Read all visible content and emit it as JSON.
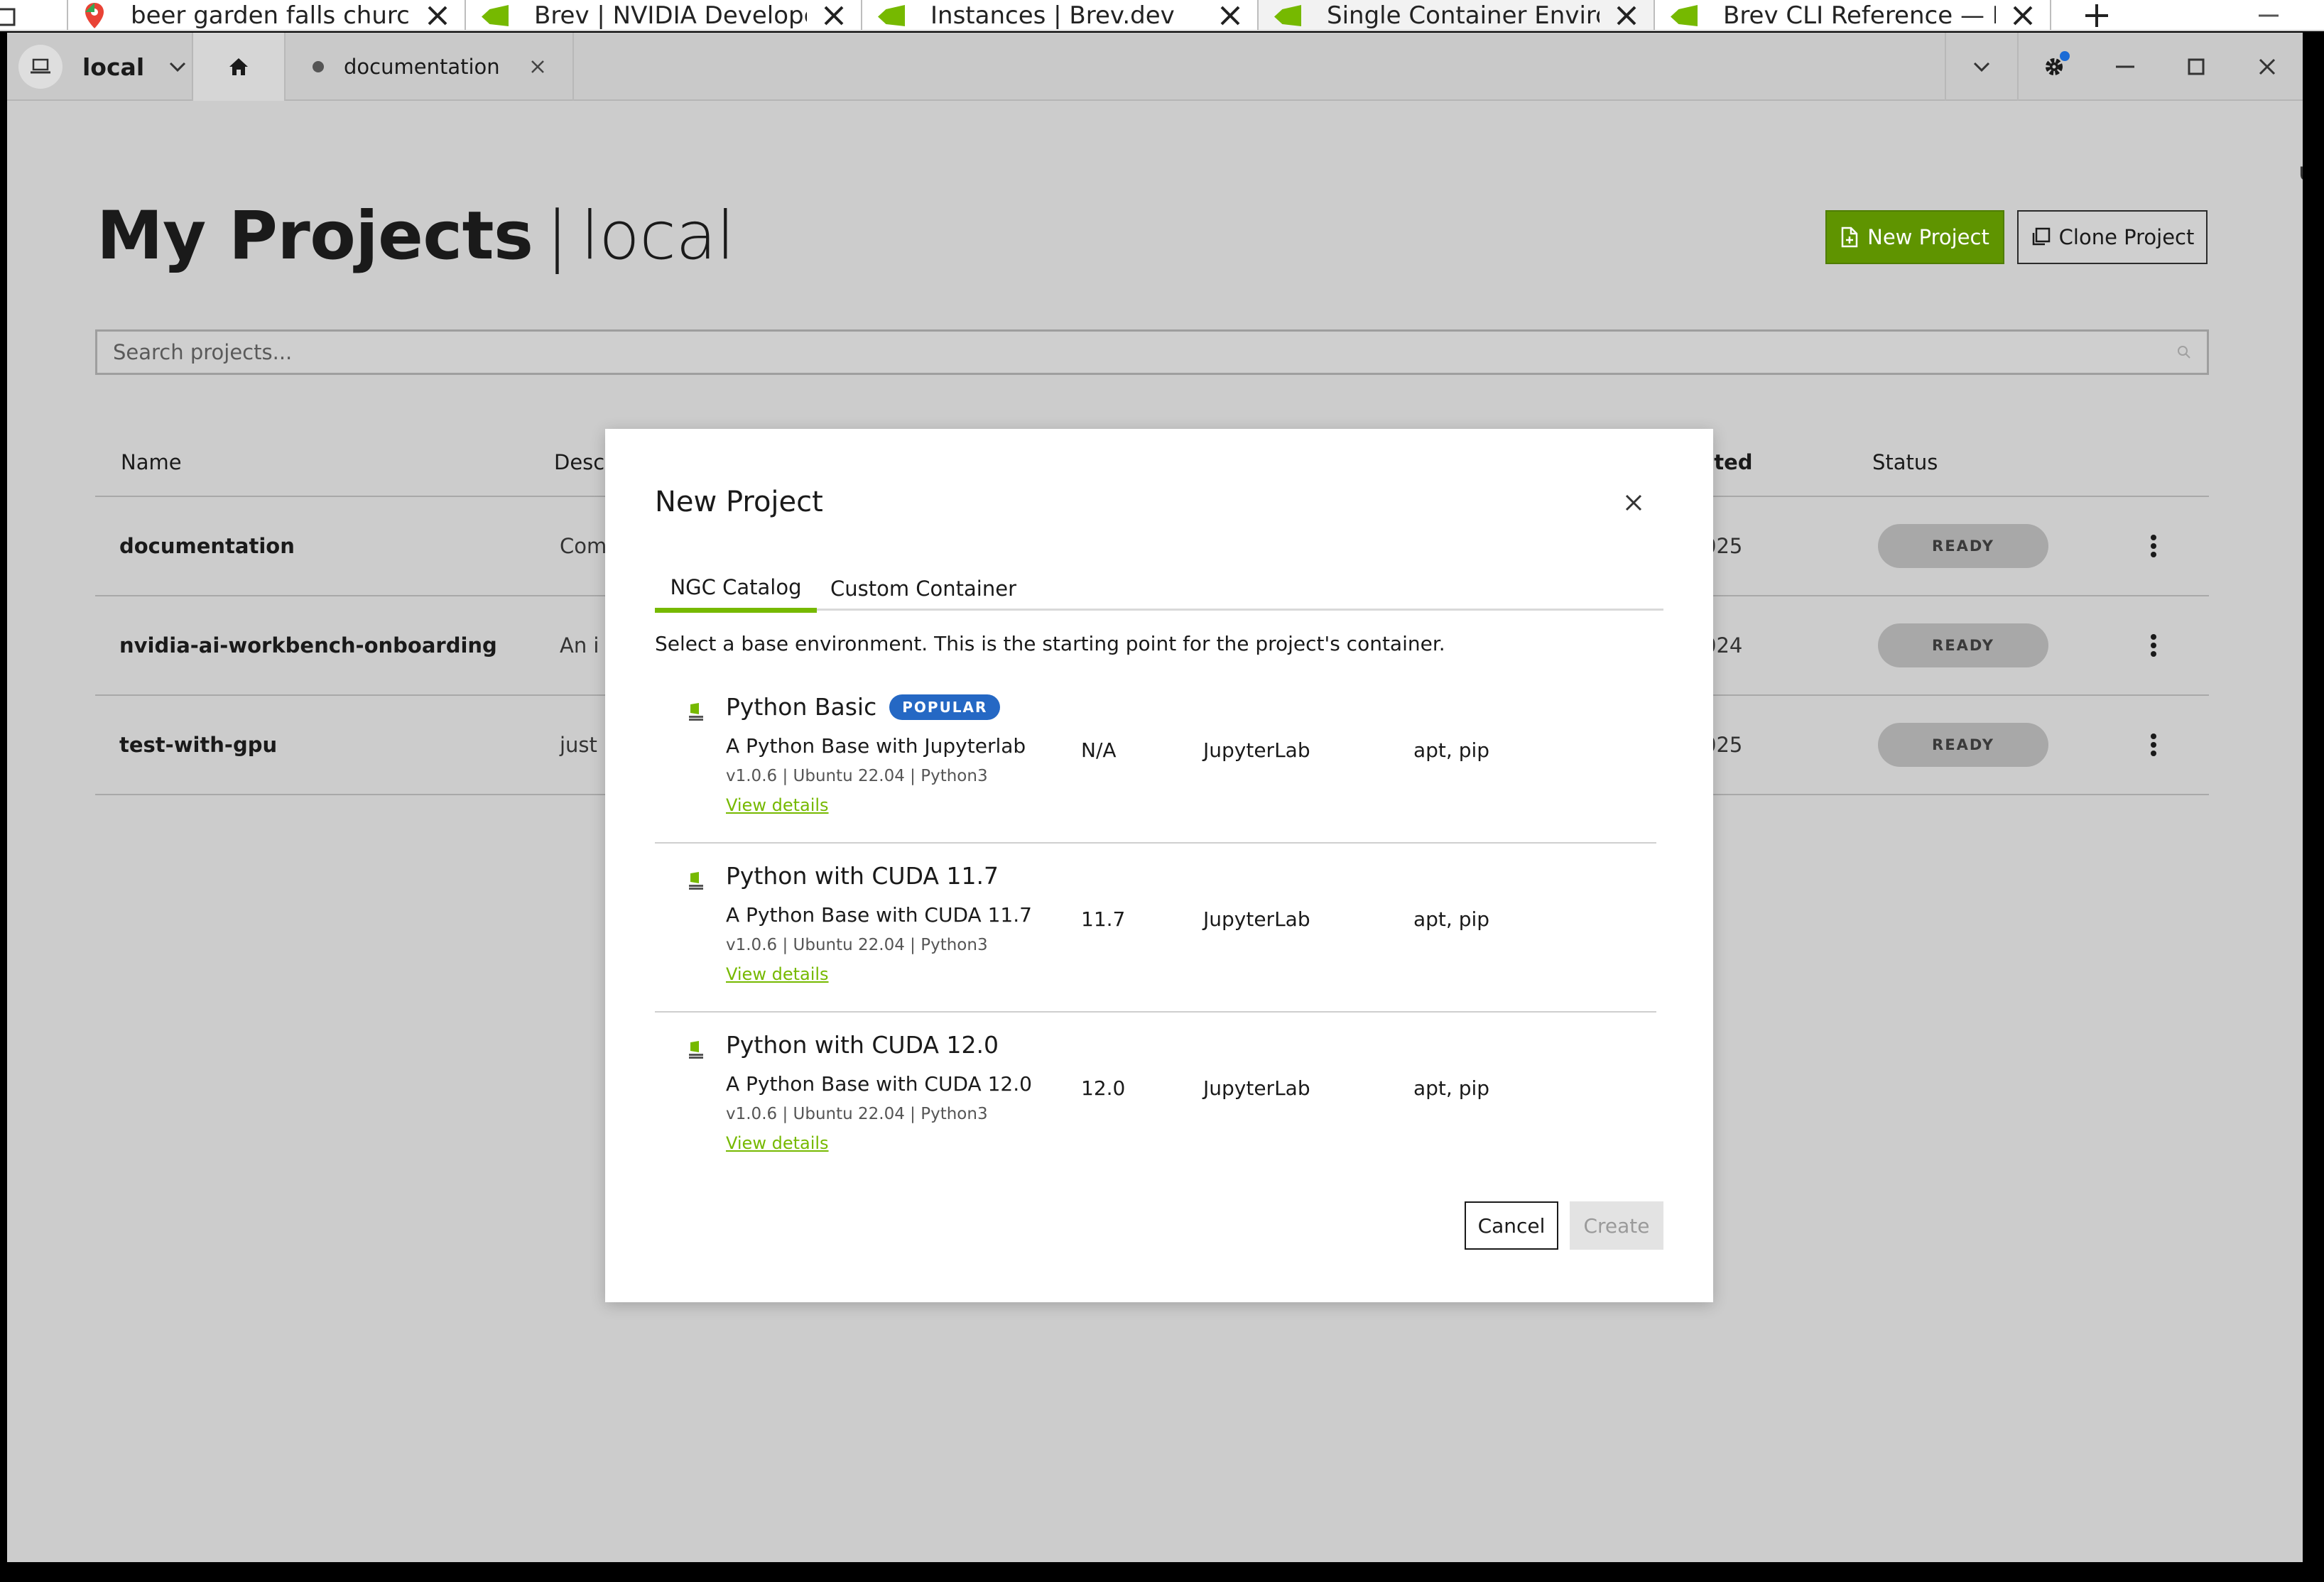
{
  "browser_tabs": [
    {
      "title": "beer garden falls church",
      "favicon": "maps-pin-icon"
    },
    {
      "title": "Brev | NVIDIA Developer",
      "favicon": "nvidia-icon"
    },
    {
      "title": "Instances | Brev.dev",
      "favicon": "nvidia-icon"
    },
    {
      "title": "Single Container Environment",
      "favicon": "nvidia-icon"
    },
    {
      "title": "Brev CLI Reference — NVIDIA",
      "favicon": "nvidia-icon"
    }
  ],
  "titlebar": {
    "context_label": "local",
    "open_tab_label": "documentation"
  },
  "page": {
    "title_bold": "My Projects",
    "title_separator": "|",
    "title_context": "local",
    "new_project_label": "New Project",
    "clone_project_label": "Clone Project",
    "search_placeholder": "Search projects...",
    "columns": {
      "name": "Name",
      "description": "Desc",
      "created": "eated",
      "status": "Status"
    },
    "edge_text": "u"
  },
  "projects": [
    {
      "name": "documentation",
      "description": "Com",
      "created": "025",
      "status": "READY"
    },
    {
      "name": "nvidia-ai-workbench-onboarding",
      "description": "An i",
      "created": "024",
      "status": "READY"
    },
    {
      "name": "test-with-gpu",
      "description": "just",
      "created": "025",
      "status": "READY"
    }
  ],
  "modal": {
    "title": "New Project",
    "tabs": [
      "NGC Catalog",
      "Custom Container"
    ],
    "active_tab": "NGC Catalog",
    "subtitle": "Select a base environment. This is the starting point for the project's container.",
    "environments": [
      {
        "name": "Python Basic",
        "badge": "POPULAR",
        "description": "A Python Base with Jupyterlab",
        "meta": "v1.0.6 | Ubuntu 22.04 | Python3",
        "link": "View details",
        "cuda": "N/A",
        "app": "JupyterLab",
        "packages": "apt, pip"
      },
      {
        "name": "Python with CUDA 11.7",
        "badge": "",
        "description": "A Python Base with CUDA 11.7",
        "meta": "v1.0.6 | Ubuntu 22.04 | Python3",
        "link": "View details",
        "cuda": "11.7",
        "app": "JupyterLab",
        "packages": "apt, pip"
      },
      {
        "name": "Python with CUDA 12.0",
        "badge": "",
        "description": "A Python Base with CUDA 12.0",
        "meta": "v1.0.6 | Ubuntu 22.04 | Python3",
        "link": "View details",
        "cuda": "12.0",
        "app": "JupyterLab",
        "packages": "apt, pip"
      }
    ],
    "cancel_label": "Cancel",
    "create_label": "Create"
  },
  "colors": {
    "accent_green": "#76b900",
    "button_green": "#5f9400",
    "badge_blue": "#2568c4",
    "overlay_gray": "#cccccc"
  }
}
